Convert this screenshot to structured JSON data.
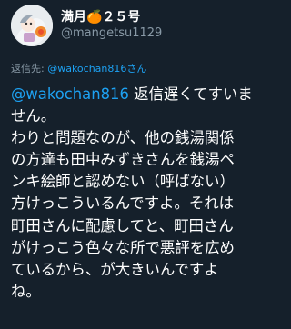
{
  "author": {
    "display_name": "満月🍊２５号",
    "screen_name": "@mangetsu1129"
  },
  "reply": {
    "prefix": "返信先: ",
    "handle": "@wakochan816さん"
  },
  "tweet": {
    "mention": "@wakochan816",
    "lines": [
      " 返信遅くてすいま",
      "せん。",
      "わりと問題なのが、他の銭湯関係",
      "の方達も田中みずきさんを銭湯ペ",
      "ンキ絵師と認めない（呼ばない）",
      "方けっこういるんですよ。それは",
      "町田さんに配慮してと、町田さん",
      "がけっこう色々な所で悪評を広め",
      "ているから、が大きいんですよ",
      "ね。"
    ]
  }
}
